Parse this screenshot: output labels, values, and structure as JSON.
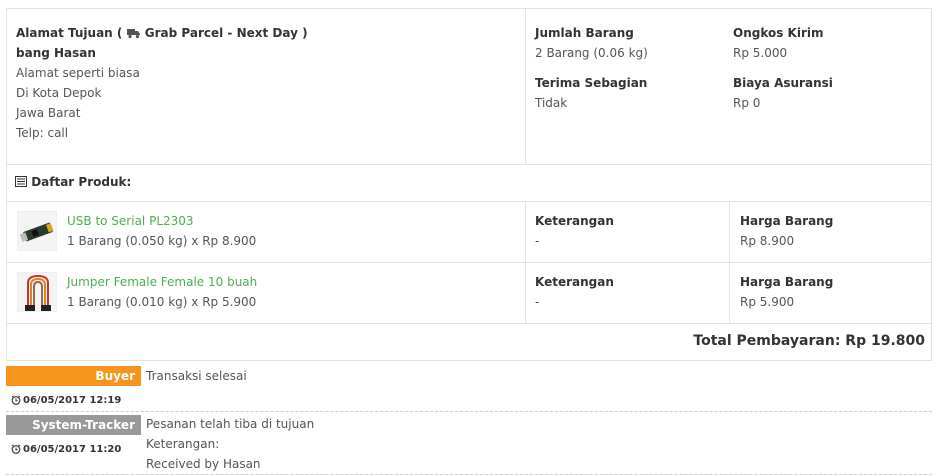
{
  "address": {
    "title_prefix": "Alamat Tujuan (",
    "courier": "Grab Parcel - Next Day )",
    "recipient": "bang Hasan",
    "line1": "Alamat seperti biasa",
    "line2": "Di Kota Depok",
    "line3": "Jawa Barat",
    "phone": "Telp: call"
  },
  "summary": {
    "jumlah_label": "Jumlah Barang",
    "jumlah_value": "2 Barang (0.06 kg)",
    "ongkos_label": "Ongkos Kirim",
    "ongkos_value": "Rp 5.000",
    "terima_label": "Terima Sebagian",
    "terima_value": "Tidak",
    "asuransi_label": "Biaya Asuransi",
    "asuransi_value": "Rp 0"
  },
  "products_header": "Daftar Produk:",
  "products": [
    {
      "name": "USB to Serial PL2303",
      "detail": "1 Barang (0.050 kg) x Rp 8.900",
      "note_label": "Keterangan",
      "note_value": "-",
      "price_label": "Harga Barang",
      "price_value": "Rp 8.900"
    },
    {
      "name": "Jumper Female Female 10 buah",
      "detail": "1 Barang (0.010 kg) x Rp 5.900",
      "note_label": "Keterangan",
      "note_value": "-",
      "price_label": "Harga Barang",
      "price_value": "Rp 5.900"
    }
  ],
  "total": "Total Pembayaran: Rp 19.800",
  "history": [
    {
      "actor": "Buyer",
      "actor_color": "#f7941d",
      "message": "Transaksi selesai",
      "time": "06/05/2017 12:19"
    },
    {
      "actor": "System-Tracker",
      "actor_color": "#999999",
      "message": "Pesanan telah tiba di tujuan",
      "note_label": "Keterangan:",
      "note_value": "Received by Hasan",
      "time": "06/05/2017 11:20"
    }
  ],
  "colors": {
    "link_green": "#4caf50",
    "border": "#e3e3e3"
  }
}
